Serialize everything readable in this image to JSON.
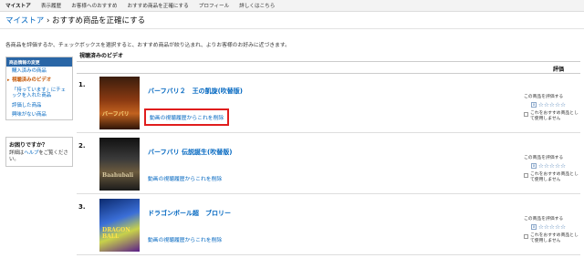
{
  "topnav": [
    "マイストア",
    "表示履歴",
    "お客様へのおすすめ",
    "おすすめ商品を正確にする",
    "プロフィール",
    "詳しくはこちら"
  ],
  "breadcrumb": {
    "link": "マイストア",
    "rest": " › おすすめ商品を正確にする"
  },
  "intro": "各商品を評価するか、チェックボックスを選択すると、おすすめ商品が絞り込まれ、よりお客様のお好みに近づきます。",
  "sidebar": {
    "header": "商品情報の変更",
    "items": [
      {
        "label": "購入済みの商品",
        "active": false
      },
      {
        "label": "視聴済みのビデオ",
        "active": true
      },
      {
        "label": "「持っています」にチェックを入れた商品",
        "active": false
      },
      {
        "label": "評価した商品",
        "active": false
      },
      {
        "label": "興味がない商品",
        "active": false
      }
    ]
  },
  "help": {
    "title": "お困りですか？",
    "prefix": "詳細は",
    "link": "ヘルプ",
    "suffix": "をご覧ください。"
  },
  "section_title": "視聴済みのビデオ",
  "column_rating": "評価",
  "rating": {
    "label": "この商品を評価する",
    "stars": "☆☆☆☆☆",
    "clear": "x",
    "own": "これをおすすめ商品として使用しません"
  },
  "items": [
    {
      "num": "1.",
      "title": "バーフバリ２　王の凱旋(吹替版)",
      "remove": "動画の視聴履歴からこれを削除",
      "poster_text": "バーフバリ",
      "highlight": true
    },
    {
      "num": "2.",
      "title": "バーフバリ 伝説誕生(吹替版)",
      "remove": "動画の視聴履歴からこれを削除",
      "poster_text": "Baahubali",
      "highlight": false
    },
    {
      "num": "3.",
      "title": "ドラゴンボール超　ブロリー",
      "remove": "動画の視聴履歴からこれを削除",
      "poster_text": "DRAGON BALL",
      "highlight": false
    }
  ]
}
